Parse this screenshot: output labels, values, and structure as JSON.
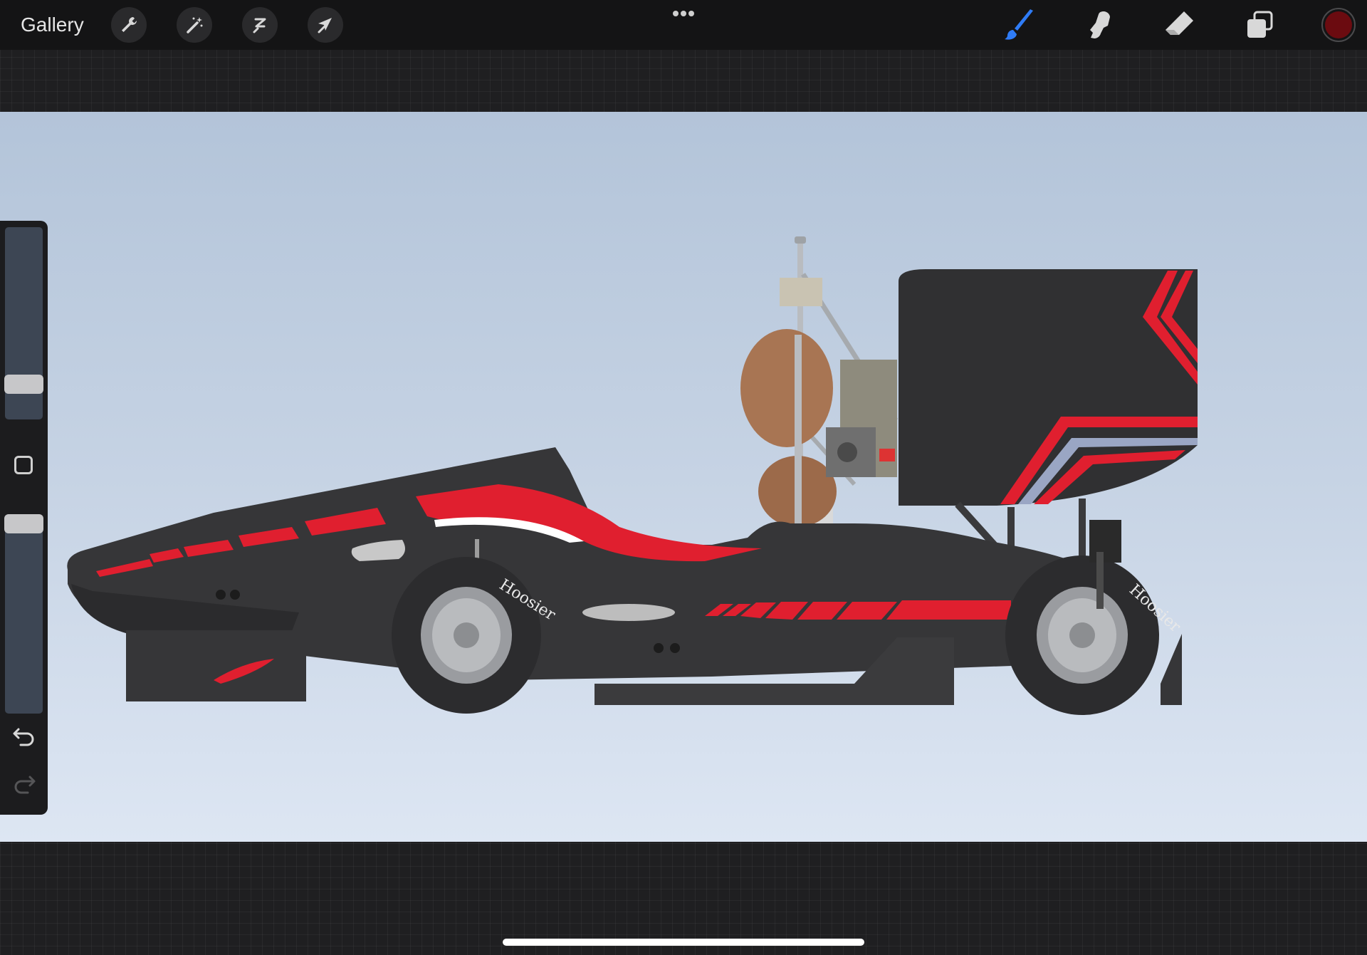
{
  "toolbar": {
    "gallery_label": "Gallery",
    "left_tools": [
      "wrench-icon",
      "magic-wand-icon",
      "selection-icon",
      "transform-arrow-icon"
    ],
    "more_menu": "more-dots-icon",
    "right_tools": [
      "brush-icon",
      "smudge-icon",
      "eraser-icon",
      "layers-icon"
    ],
    "active_tool": "brush",
    "active_tool_color": "#2f7cf6",
    "current_color": "#6b0b10"
  },
  "sidebar": {
    "brush_size": 0.78,
    "brush_opacity": 0.95,
    "modify_button": "square-icon",
    "undo": "undo-icon",
    "redo": "redo-icon"
  },
  "canvas_content": {
    "tire_brand_text": "Hoosier",
    "livery_colors": [
      "#2f2f31",
      "#e01f2f",
      "#ffffff"
    ]
  }
}
